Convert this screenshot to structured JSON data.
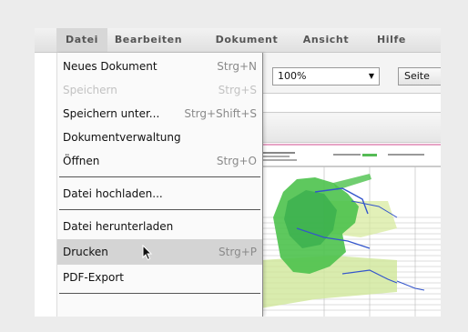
{
  "menubar": {
    "items": [
      {
        "label": "Datei"
      },
      {
        "label": "Bearbeiten"
      },
      {
        "label": "Dokument"
      },
      {
        "label": "Ansicht"
      },
      {
        "label": "Hilfe"
      }
    ]
  },
  "toolbar": {
    "zoom_value": "100%",
    "page_button_label": "Seite"
  },
  "file_menu": {
    "items": [
      {
        "label": "Neues Dokument",
        "shortcut": "Strg+N"
      },
      {
        "label": "Speichern",
        "shortcut": "Strg+S"
      },
      {
        "label": "Speichern unter...",
        "shortcut": "Strg+Shift+S"
      },
      {
        "label": "Dokumentverwaltung",
        "shortcut": ""
      },
      {
        "label": "Öffnen",
        "shortcut": "Strg+O"
      },
      {
        "label": "Datei hochladen...",
        "shortcut": ""
      },
      {
        "label": "Datei herunterladen",
        "shortcut": ""
      },
      {
        "label": "Drucken",
        "shortcut": "Strg+P"
      },
      {
        "label": "PDF-Export",
        "shortcut": ""
      }
    ]
  },
  "colors": {
    "menu_hover": "#d4d4d4",
    "doc_accent_line": "#e7a5c6",
    "chart_green": "#4cc24c",
    "chart_blue": "#3355cc"
  }
}
